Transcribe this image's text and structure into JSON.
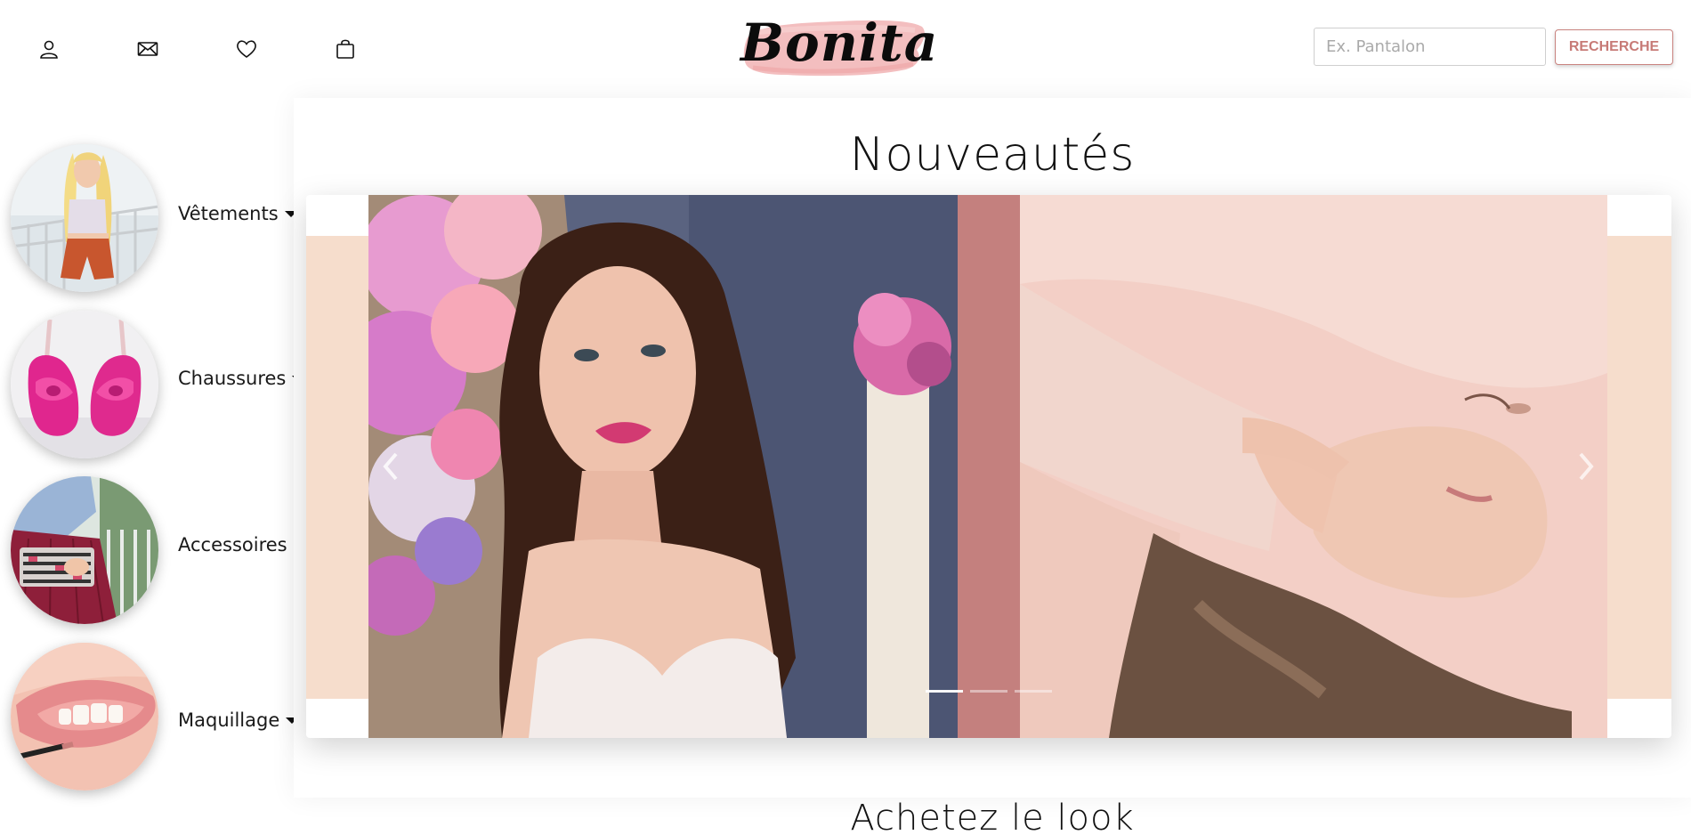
{
  "header": {
    "icons": [
      "user-icon",
      "mail-icon",
      "heart-icon",
      "bag-icon"
    ],
    "logo_text": "Bonita",
    "search": {
      "placeholder": "Ex. Pantalon",
      "value": ""
    },
    "search_button_label": "RECHERCHE"
  },
  "sidebar": {
    "categories": [
      {
        "label": "Vêtements"
      },
      {
        "label": "Chaussures"
      },
      {
        "label": "Accessoires"
      },
      {
        "label": "Maquillage"
      }
    ]
  },
  "main": {
    "title": "Nouveautés",
    "carousel": {
      "slide_count": 3,
      "active_index": 0
    },
    "next_title": "Achetez le look"
  },
  "colors": {
    "accent": "#c4807e",
    "button_text": "#c77a76",
    "band": "#f6ddcc",
    "logo_brush": "#f2b7b8"
  }
}
